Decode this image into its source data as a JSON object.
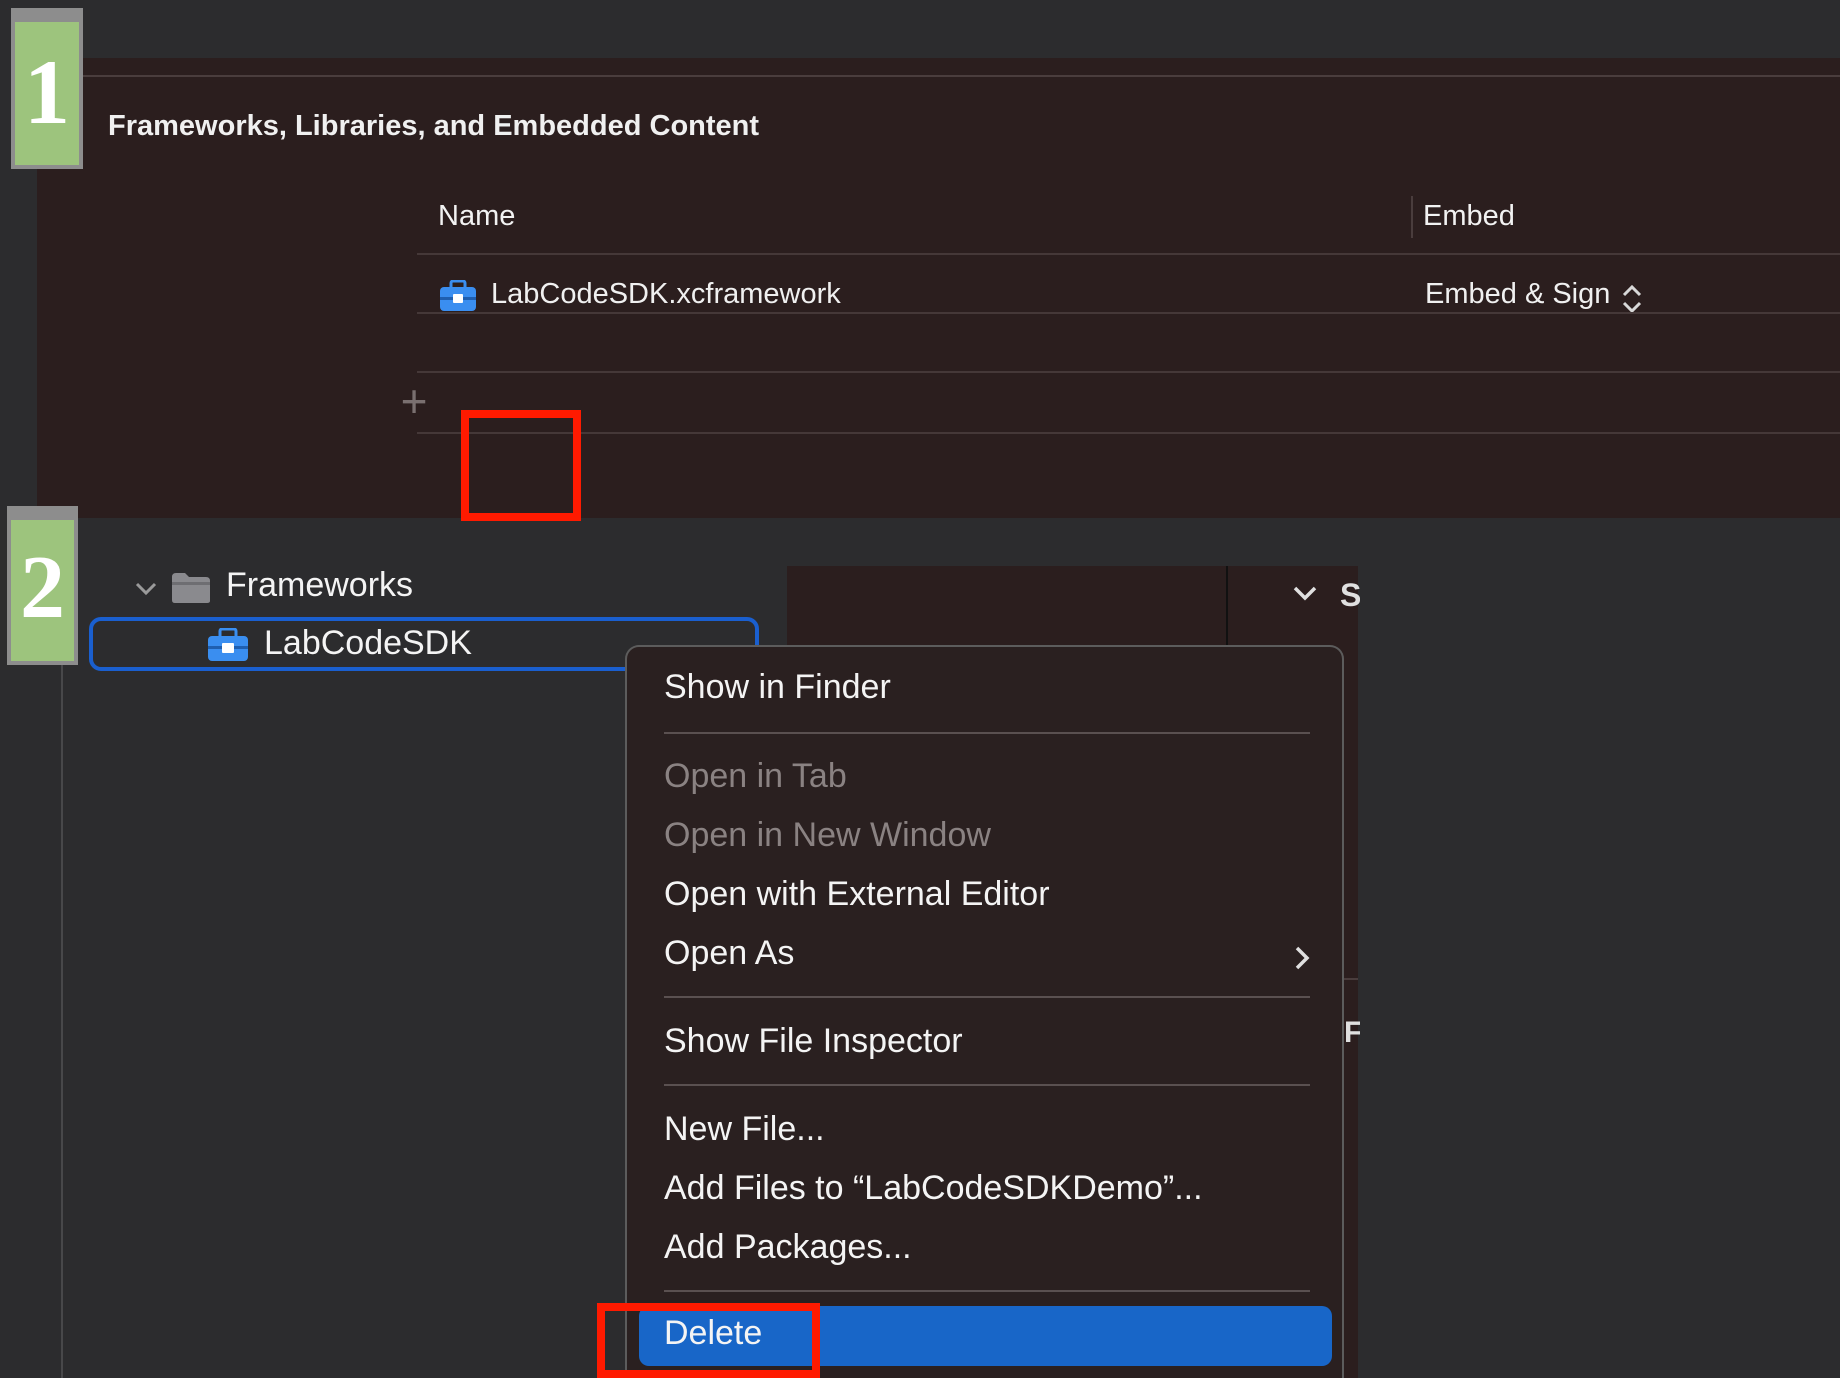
{
  "badges": {
    "step1": "1",
    "step2": "2"
  },
  "frameworks_section": {
    "title": "Frameworks, Libraries, and Embedded Content",
    "columns": {
      "name": "Name",
      "embed": "Embed"
    },
    "rows": [
      {
        "name": "LabCodeSDK.xcframework",
        "embed": "Embed & Sign",
        "icon": "toolbox-icon"
      }
    ],
    "add_button": "+",
    "remove_button": "—"
  },
  "navigator": {
    "group": {
      "label": "Frameworks",
      "icon": "folder-icon"
    },
    "selected_item": {
      "label": "LabCodeSDK",
      "icon": "toolbox-icon"
    }
  },
  "editor_fragments": {
    "top_letter": "S",
    "mid_letter": "F"
  },
  "context_menu": {
    "items": [
      {
        "label": "Show in Finder",
        "enabled": true
      },
      {
        "label": "Open in Tab",
        "enabled": false
      },
      {
        "label": "Open in New Window",
        "enabled": false
      },
      {
        "label": "Open with External Editor",
        "enabled": true
      },
      {
        "label": "Open As",
        "enabled": true,
        "submenu": true
      },
      {
        "label": "Show File Inspector",
        "enabled": true
      },
      {
        "label": "New File...",
        "enabled": true
      },
      {
        "label": "Add Files to “LabCodeSDKDemo”...",
        "enabled": true
      },
      {
        "label": "Add Packages...",
        "enabled": true
      },
      {
        "label": "Delete",
        "enabled": true,
        "highlighted": true
      }
    ]
  },
  "colors": {
    "highlight": "#1866c8",
    "annotation_red": "#ff1a00",
    "badge_green": "#9dc47d",
    "selection_blue": "#1a5fcf",
    "sdk_icon_blue": "#3a8ef0"
  }
}
